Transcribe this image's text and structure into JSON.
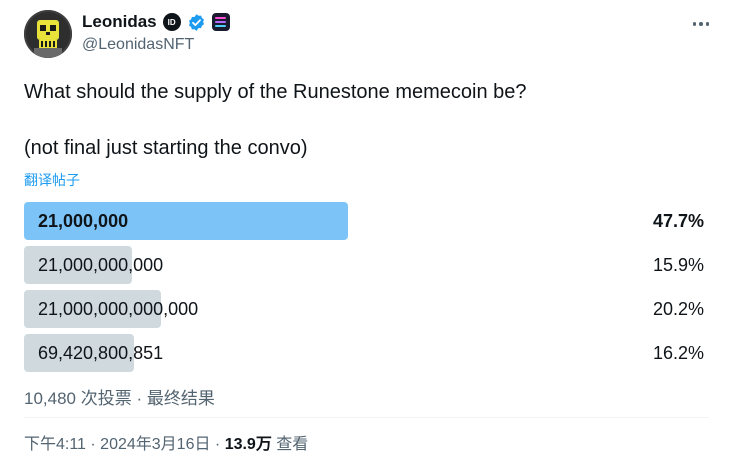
{
  "author": {
    "display_name": "Leonidas",
    "handle": "@LeonidasNFT",
    "badges": [
      "id-badge-icon",
      "verified-badge-icon",
      "app-badge-icon"
    ],
    "verified_color": "#1d9bf0"
  },
  "tweet": {
    "line1": "What should the supply of the Runestone memecoin be?",
    "line2": "(not final just starting the convo)",
    "translate_link": "翻译帖子"
  },
  "poll": {
    "options": [
      {
        "label": "21,000,000",
        "percent": "47.7%",
        "fraction": 0.477,
        "winner": true
      },
      {
        "label": "21,000,000,000",
        "percent": "15.9%",
        "fraction": 0.159,
        "winner": false
      },
      {
        "label": "21,000,000,000,000",
        "percent": "20.2%",
        "fraction": 0.202,
        "winner": false
      },
      {
        "label": "69,420,800,851",
        "percent": "16.2%",
        "fraction": 0.162,
        "winner": false
      }
    ],
    "meta": "10,480 次投票 · 最终结果",
    "winner_color": "#7cc4f8",
    "other_color": "#cfd9de"
  },
  "footer": {
    "time_date": "下午4:11 · 2024年3月16日 · ",
    "views_count": "13.9万",
    "views_label": " 查看"
  }
}
